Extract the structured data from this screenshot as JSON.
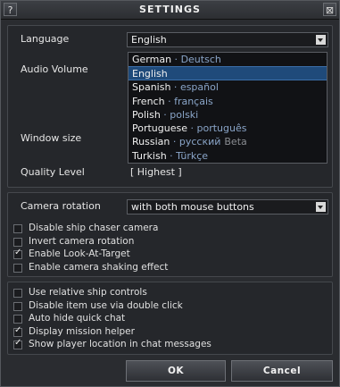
{
  "window": {
    "title": "SETTINGS",
    "help_glyph": "?",
    "close_glyph": "⊠"
  },
  "general": {
    "language_label": "Language",
    "language_value": "English",
    "audio_label": "Audio Volume",
    "window_size_label": "Window size",
    "quality_label": "Quality Level",
    "quality_value": "[ Highest ]"
  },
  "language_options": [
    {
      "name": "German",
      "native": "Deutsch",
      "note": ""
    },
    {
      "name": "English",
      "native": "",
      "note": "",
      "selected": true
    },
    {
      "name": "Spanish",
      "native": "español",
      "note": ""
    },
    {
      "name": "French",
      "native": "français",
      "note": ""
    },
    {
      "name": "Polish",
      "native": "polski",
      "note": ""
    },
    {
      "name": "Portuguese",
      "native": "português",
      "note": ""
    },
    {
      "name": "Russian",
      "native": "русский",
      "note": "Beta"
    },
    {
      "name": "Turkish",
      "native": "Türkçe",
      "note": ""
    }
  ],
  "separator": " · ",
  "camera": {
    "rotation_label": "Camera rotation",
    "rotation_value": "with both mouse buttons",
    "options": [
      {
        "label": "Disable ship chaser camera",
        "checked": false
      },
      {
        "label": "Invert camera rotation",
        "checked": false
      },
      {
        "label": "Enable Look-At-Target",
        "checked": true
      },
      {
        "label": "Enable camera shaking effect",
        "checked": false
      }
    ]
  },
  "controls": {
    "options": [
      {
        "label": "Use relative ship controls",
        "checked": false
      },
      {
        "label": "Disable item use via double click",
        "checked": false
      },
      {
        "label": "Auto hide quick chat",
        "checked": false
      },
      {
        "label": "Display mission helper",
        "checked": true
      },
      {
        "label": "Show player location in chat messages",
        "checked": true
      }
    ]
  },
  "buttons": {
    "ok": "OK",
    "cancel": "Cancel"
  }
}
